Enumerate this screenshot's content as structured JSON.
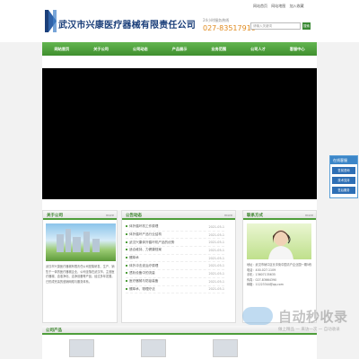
{
  "header": {
    "company_name": "武汉市兴康医疗器械有限责任公司",
    "top_links": [
      "网站首页",
      "网站地图",
      "加入收藏"
    ],
    "hotline_label": "24小时服务热线",
    "hotline_number": "027-83517910",
    "search_placeholder": "请输入关键词",
    "search_button": "搜索"
  },
  "nav": [
    "网站首页",
    "关于公司",
    "公司动态",
    "产品展示",
    "业务范围",
    "公司人才",
    "客服中心"
  ],
  "about": {
    "title": "关于公司",
    "more": "more",
    "text": "武汉市兴康医疗器械有限责任公司是集研发、生产、销售于一体的医疗器械企业，公司坐落在武汉市，主营医疗器械、血液净化、洁净设备等产品，经过多年发展，已形成完善的营销网络与服务体系。"
  },
  "news": {
    "title": "公告动态",
    "more": "more",
    "items": [
      {
        "title": "体外循环机工作原理",
        "date": "2021-05-1"
      },
      {
        "title": "体外循环产品行业结构",
        "date": "2021-05-1"
      },
      {
        "title": "武汉兴康体外循环机产品的优势",
        "date": "2021-05-1"
      },
      {
        "title": "适合维持、力健康档案",
        "date": "2021-05-1"
      },
      {
        "title": "蠕萃术",
        "date": "2021-05-1"
      },
      {
        "title": "体外冲击波治疗原理",
        "date": "2021-05-1"
      },
      {
        "title": "透析设备中的流量",
        "date": "2021-05-1"
      },
      {
        "title": "医疗器械与防疫装备",
        "date": "2021-05-1"
      },
      {
        "title": "蠕萃术、物理疗法",
        "date": "2021-05-1"
      }
    ]
  },
  "contact": {
    "title": "联系方式",
    "more": "more",
    "lines": [
      "地址：武汉市硚口区长丰街中国青户企业园一期5栋",
      "电话：400-027-1109",
      "手机：13607135635",
      "传真：027-83664390",
      "邮箱：11223344@qq.com"
    ]
  },
  "products": {
    "title": "公司产品"
  },
  "service": {
    "title": "在线客服",
    "items": [
      "售前咨询",
      "技术支持",
      "售后服务"
    ]
  },
  "watermark": {
    "main": "自动秒收录",
    "sub": "做上精品 一 来访一次 一 自动收录"
  },
  "colors": {
    "nav_green": "#4e9d3a",
    "brand_blue": "#1b3f7a",
    "hotline_orange": "#e08a1e",
    "service_blue": "#3c86c8"
  }
}
